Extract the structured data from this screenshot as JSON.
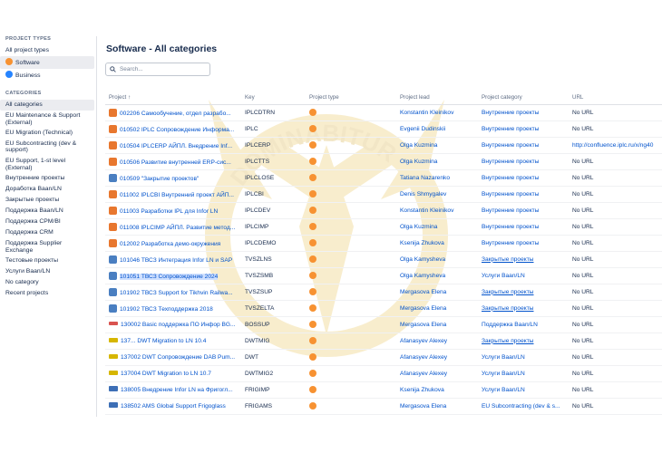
{
  "sidebar": {
    "types_heading": "PROJECT TYPES",
    "types": [
      {
        "label": "All project types",
        "icon": ""
      },
      {
        "label": "Software",
        "icon": "software-icon",
        "active": true
      },
      {
        "label": "Business",
        "icon": "business-icon"
      }
    ],
    "categories_heading": "CATEGORIES",
    "categories": [
      "All categories",
      "EU Maintenance & Support (External)",
      "EU Migration (Technical)",
      "EU Subcontracting (dev & support)",
      "EU Support, 1-st level (External)",
      "Внутренние проекты",
      "Доработка Baan/LN",
      "Закрытые проекты",
      "Поддержка Baan/LN",
      "Поддержка CPM/BI",
      "Поддержка CRM",
      "Поддержка Supplier Exchange",
      "Тестовые проекты",
      "Услуги Baan/LN",
      "No category",
      "Recent projects"
    ]
  },
  "main": {
    "title": "Software - All categories",
    "search_placeholder": "Search..."
  },
  "table": {
    "headers": {
      "project": "Project ↑",
      "key": "Key",
      "type": "Project type",
      "lead": "Project lead",
      "category": "Project category",
      "url": "URL"
    },
    "rows": [
      {
        "name": "002206 Самообучение, отдел разрабо...",
        "key": "IPLCDTRN",
        "lead": "Konstantin Kleinikov",
        "category": "Внутренние проекты",
        "url": "No URL",
        "avatar": "orange"
      },
      {
        "name": "010502 IPLC Сопровождение Информа...",
        "key": "IPLC",
        "lead": "Evgenii Dudinskii",
        "category": "Внутренние проекты",
        "url": "No URL",
        "avatar": "orange"
      },
      {
        "name": "010504 IPLCERP АЙПЛ. Внедрение Inf...",
        "key": "IPLCERP",
        "lead": "Olga Kuzmina",
        "category": "Внутренние проекты",
        "url": "http://confluence.iplc.ru/x/ng40",
        "avatar": "orange"
      },
      {
        "name": "010506 Развитие внутренней ERP-сис...",
        "key": "IPLCTTS",
        "lead": "Olga Kuzmina",
        "category": "Внутренние проекты",
        "url": "No URL",
        "avatar": "orange"
      },
      {
        "name": "010509 \"Закрытие проектов\"",
        "key": "IPLCLOSE",
        "lead": "Tatiana Nazarenko",
        "category": "Внутренние проекты",
        "url": "No URL",
        "avatar": "blue"
      },
      {
        "name": "011002 IPLCBI Внутренний проект АЙП...",
        "key": "IPLCBI",
        "lead": "Denis Shmygalev",
        "category": "Внутренние проекты",
        "url": "No URL",
        "avatar": "orange"
      },
      {
        "name": "011003 Разработки IPL для Infor LN",
        "key": "IPLCDEV",
        "lead": "Konstantin Kleinikov",
        "category": "Внутренние проекты",
        "url": "No URL",
        "avatar": "orange"
      },
      {
        "name": "011008 IPLCIMP АЙПЛ. Развитие метод...",
        "key": "IPLCIMP",
        "lead": "Olga Kuzmina",
        "category": "Внутренние проекты",
        "url": "No URL",
        "avatar": "orange"
      },
      {
        "name": "012002 Разработка демо-окружения",
        "key": "IPLCDEMO",
        "lead": "Ksenija Zhukova",
        "category": "Внутренние проекты",
        "url": "No URL",
        "avatar": "orange"
      },
      {
        "name": "101046 ТВСЗ Интеграция Infor LN и SAP",
        "key": "TVSZLNS",
        "lead": "Olga Kamysheva",
        "category": "Закрытые проекты",
        "url": "No URL",
        "avatar": "blue"
      },
      {
        "name": "101051 ТВСЗ Сопровождение 2024",
        "key": "TVSZSMB",
        "lead": "Olga Kamysheva",
        "category": "Услуги Baan/LN",
        "url": "No URL",
        "avatar": "blue",
        "highlight": true
      },
      {
        "name": "101902 ТВСЗ Support for Tikhvin Railwa...",
        "key": "TVSZSUP",
        "lead": "Mergasova Elena",
        "category": "Закрытые проекты",
        "url": "No URL",
        "avatar": "blue"
      },
      {
        "name": "101902 ТВСЗ Техподдержка 2018",
        "key": "TVSZELTA",
        "lead": "Mergasova Elena",
        "category": "Закрытые проекты",
        "url": "No URL",
        "avatar": "blue"
      },
      {
        "name": "130002 Basic поддержка ПО Инфор BG...",
        "key": "BOSSUP",
        "lead": "Mergasova Elena",
        "category": "Поддержка Baan/LN",
        "url": "No URL",
        "avatar": "red"
      },
      {
        "name": "137... DWT Migration to LN 10.4",
        "key": "DWTMIG",
        "lead": "Afanasyev Alexey",
        "category": "Закрытые проекты",
        "url": "No URL",
        "avatar": "yellow"
      },
      {
        "name": "137002 DWT Сопровождение DAB Pum...",
        "key": "DWT",
        "lead": "Afanasyev Alexey",
        "category": "Услуги Baan/LN",
        "url": "No URL",
        "avatar": "yellow"
      },
      {
        "name": "137004 DWT Migration to LN 10.7",
        "key": "DWTMIG2",
        "lead": "Afanasyev Alexey",
        "category": "Услуги Baan/LN",
        "url": "No URL",
        "avatar": "yellow"
      },
      {
        "name": "138005 Внедрение Infor LN на Фригогл...",
        "key": "FRIGIMP",
        "lead": "Ksenija Zhukova",
        "category": "Услуги Baan/LN",
        "url": "No URL",
        "avatar": "navy"
      },
      {
        "name": "138502 AMS Global Support Frigoglass",
        "key": "FRIGAMS",
        "lead": "Mergasova Elena",
        "category": "EU Subcontracting (dev & s...",
        "url": "No URL",
        "avatar": "navy"
      }
    ]
  },
  "watermark": {
    "text": "DOMINABITUR"
  },
  "colors": {
    "link": "#0052cc",
    "software_type": "#f79232",
    "business_type": "#2684ff"
  }
}
